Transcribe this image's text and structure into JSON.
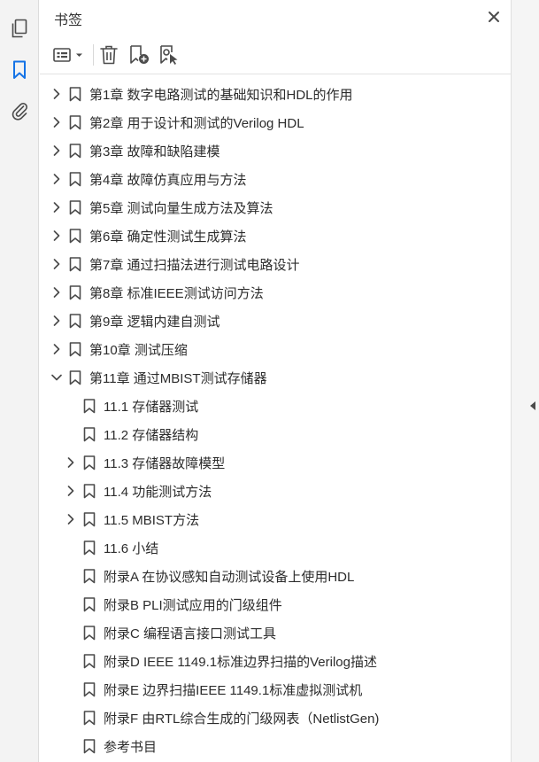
{
  "panel": {
    "title": "书签"
  },
  "bookmarks": [
    {
      "label": "第1章 数字电路测试的基础知识和HDL的作用",
      "level": 0,
      "expandable": true,
      "expanded": false
    },
    {
      "label": "第2章 用于设计和测试的Verilog HDL",
      "level": 0,
      "expandable": true,
      "expanded": false
    },
    {
      "label": "第3章 故障和缺陷建模",
      "level": 0,
      "expandable": true,
      "expanded": false
    },
    {
      "label": "第4章 故障仿真应用与方法",
      "level": 0,
      "expandable": true,
      "expanded": false
    },
    {
      "label": "第5章 测试向量生成方法及算法",
      "level": 0,
      "expandable": true,
      "expanded": false
    },
    {
      "label": "第6章 确定性测试生成算法",
      "level": 0,
      "expandable": true,
      "expanded": false
    },
    {
      "label": "第7章 通过扫描法进行测试电路设计",
      "level": 0,
      "expandable": true,
      "expanded": false
    },
    {
      "label": "第8章 标准IEEE测试访问方法",
      "level": 0,
      "expandable": true,
      "expanded": false
    },
    {
      "label": "第9章 逻辑内建自测试",
      "level": 0,
      "expandable": true,
      "expanded": false
    },
    {
      "label": "第10章 测试压缩",
      "level": 0,
      "expandable": true,
      "expanded": false
    },
    {
      "label": "第11章 通过MBIST测试存储器",
      "level": 0,
      "expandable": true,
      "expanded": true
    },
    {
      "label": "11.1 存储器测试",
      "level": 1,
      "expandable": false,
      "expanded": false
    },
    {
      "label": "11.2 存储器结构",
      "level": 1,
      "expandable": false,
      "expanded": false
    },
    {
      "label": "11.3 存储器故障模型",
      "level": 1,
      "expandable": true,
      "expanded": false
    },
    {
      "label": "11.4 功能测试方法",
      "level": 1,
      "expandable": true,
      "expanded": false
    },
    {
      "label": "11.5 MBIST方法",
      "level": 1,
      "expandable": true,
      "expanded": false
    },
    {
      "label": "11.6 小结",
      "level": 1,
      "expandable": false,
      "expanded": false
    },
    {
      "label": "附录A  在协议感知自动测试设备上使用HDL",
      "level": 1,
      "expandable": false,
      "expanded": false
    },
    {
      "label": "附录B  PLI测试应用的门级组件",
      "level": 1,
      "expandable": false,
      "expanded": false
    },
    {
      "label": "附录C  编程语言接口测试工具",
      "level": 1,
      "expandable": false,
      "expanded": false
    },
    {
      "label": "附录D  IEEE 1149.1标准边界扫描的Verilog描述",
      "level": 1,
      "expandable": false,
      "expanded": false
    },
    {
      "label": "附录E  边界扫描IEEE 1149.1标准虚拟测试机",
      "level": 1,
      "expandable": false,
      "expanded": false
    },
    {
      "label": "附录F  由RTL综合生成的门级网表（NetlistGen)",
      "level": 1,
      "expandable": false,
      "expanded": false
    },
    {
      "label": "参考书目",
      "level": 1,
      "expandable": false,
      "expanded": false
    }
  ],
  "colors": {
    "accent": "#1473e6",
    "icon": "#4b4b4b",
    "text": "#2c2c2c"
  }
}
